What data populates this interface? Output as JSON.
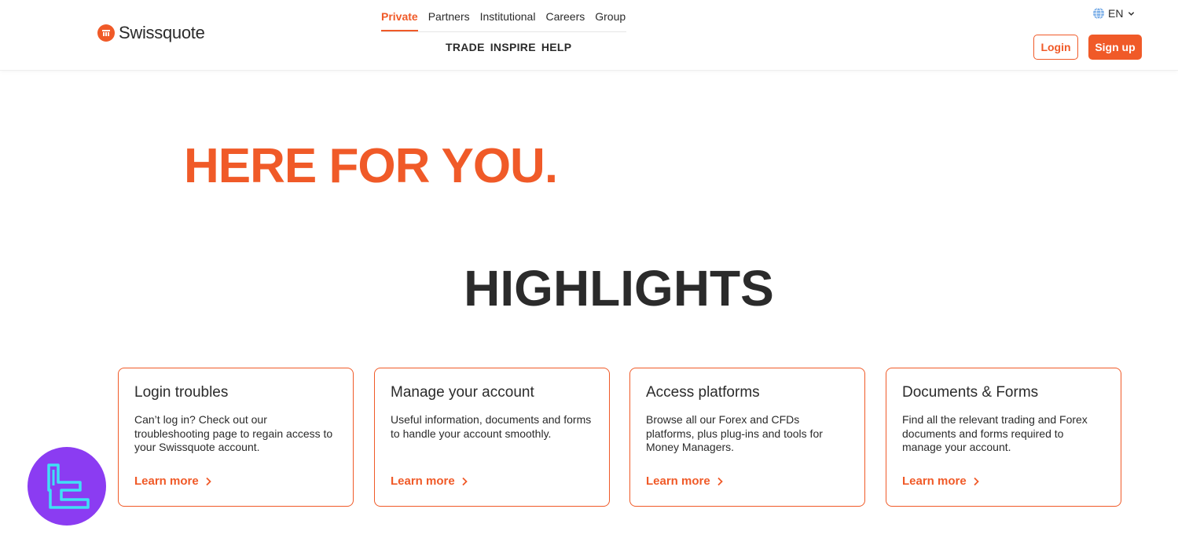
{
  "colors": {
    "brand": "#f05a28",
    "text": "#2b2b2b",
    "badge": "#8b3cf2",
    "badge_mark": "#3fe0f5"
  },
  "header": {
    "brand_name": "Swissquote",
    "top_nav": [
      "Private",
      "Partners",
      "Institutional",
      "Careers",
      "Group"
    ],
    "active_nav": "Private",
    "sub_nav": [
      "TRADE",
      "INSPIRE",
      "HELP"
    ],
    "language": "EN",
    "login_label": "Login",
    "signup_label": "Sign up"
  },
  "hero": {
    "title": "HERE FOR YOU."
  },
  "highlights": {
    "title": "HIGHLIGHTS",
    "cards": [
      {
        "title": "Login troubles",
        "description": "Can’t log in? Check out our troubleshooting page to regain access to your Swissquote account.",
        "link": "Learn more"
      },
      {
        "title": "Manage your account",
        "description": "Useful information, documents and forms to handle your account smoothly.",
        "link": "Learn more"
      },
      {
        "title": "Access platforms",
        "description": "Browse all our Forex and CFDs platforms, plus plug-ins and tools for Money Managers.",
        "link": "Learn more"
      },
      {
        "title": "Documents & Forms",
        "description": "Find all the relevant trading and Forex documents and forms required to manage your account.",
        "link": "Learn more"
      }
    ]
  },
  "icons": {
    "logo": "swissquote-logo-icon",
    "language": "globe-icon",
    "dropdown": "chevron-down-icon",
    "link_arrow": "chevron-right-icon",
    "badge": "tc-logo-icon"
  }
}
